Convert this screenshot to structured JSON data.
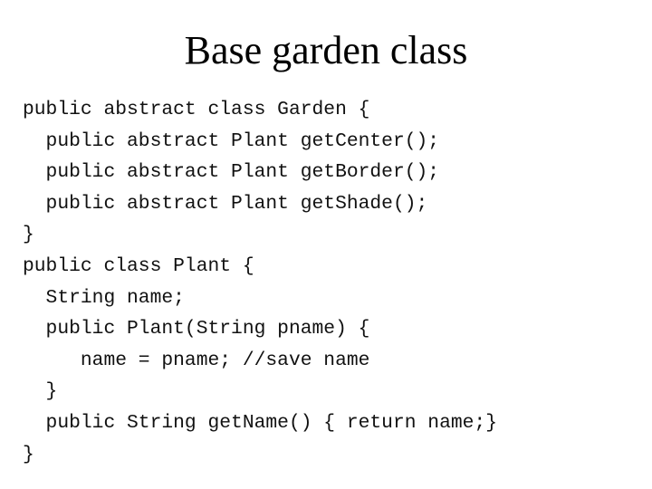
{
  "slide": {
    "title": "Base garden class",
    "code_lines": [
      "public abstract class Garden {",
      "  public abstract Plant getCenter();",
      "  public abstract Plant getBorder();",
      "  public abstract Plant getShade();",
      "}",
      "public class Plant {",
      "  String name;",
      "  public Plant(String pname) {",
      "     name = pname; //save name",
      "  }",
      "  public String getName() { return name;}",
      "}"
    ]
  }
}
